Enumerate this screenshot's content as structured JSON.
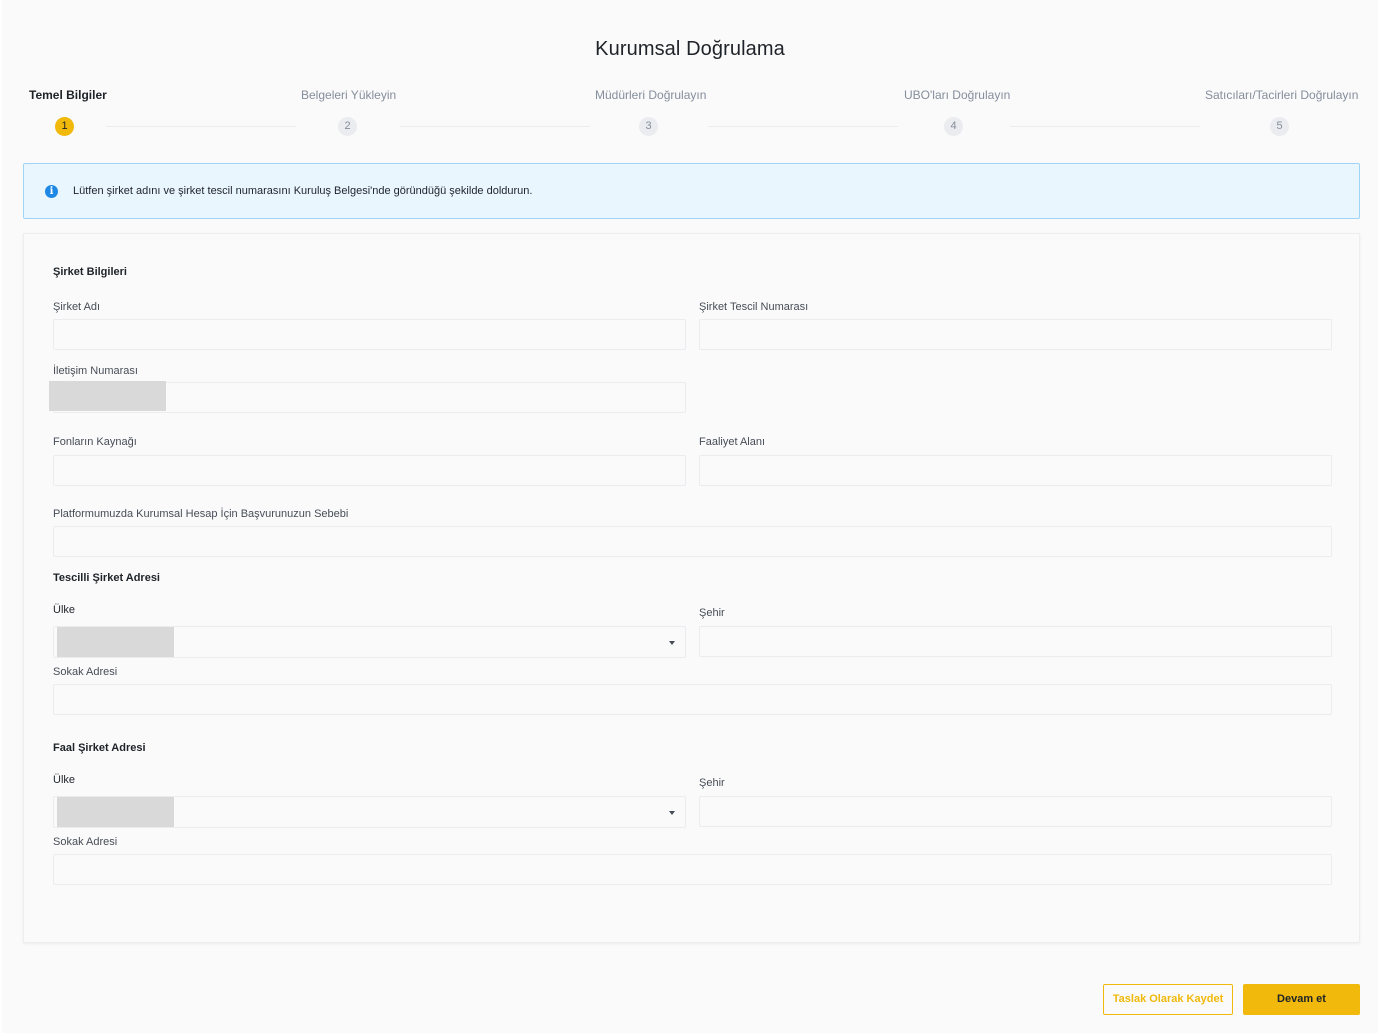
{
  "page": {
    "title": "Kurumsal Doğrulama"
  },
  "stepper": {
    "steps": [
      {
        "number": "1",
        "label": "Temel Bilgiler",
        "active": true
      },
      {
        "number": "2",
        "label": "Belgeleri Yükleyin",
        "active": false
      },
      {
        "number": "3",
        "label": "Müdürleri Doğrulayın",
        "active": false
      },
      {
        "number": "4",
        "label": "UBO'ları Doğrulayın",
        "active": false
      },
      {
        "number": "5",
        "label": "Satıcıları/Tacirleri Doğrulayın",
        "active": false
      }
    ]
  },
  "info_banner": {
    "icon": "info-icon",
    "text": "Lütfen şirket adını ve şirket tescil numarasını Kuruluş Belgesi'nde göründüğü şekilde doldurun."
  },
  "company_info": {
    "title": "Şirket Bilgileri",
    "company_name_label": "Şirket Adı",
    "company_name_value": "",
    "registration_number_label": "Şirket Tescil Numarası",
    "registration_number_value": "",
    "contact_number_label": "İletişim Numarası",
    "contact_number_value": "",
    "source_of_funds_label": "Fonların Kaynağı",
    "source_of_funds_value": "",
    "business_area_label": "Faaliyet Alanı",
    "business_area_value": "",
    "reason_label": "Platformumuzda Kurumsal Hesap İçin Başvurunuzun Sebebi",
    "reason_value": ""
  },
  "registered_address": {
    "title": "Tescilli Şirket Adresi",
    "country_label": "Ülke",
    "city_label": "Şehir",
    "city_value": "",
    "street_label": "Sokak Adresi",
    "street_value": ""
  },
  "operating_address": {
    "title": "Faal Şirket Adresi",
    "country_label": "Ülke",
    "city_label": "Şehir",
    "city_value": "",
    "street_label": "Sokak Adresi",
    "street_value": ""
  },
  "actions": {
    "save_draft_label": "Taslak Olarak Kaydet",
    "continue_label": "Devam et"
  },
  "colors": {
    "accent": "#f0b90b",
    "info_background": "#eaf6fe",
    "info_border": "#9fd4f7",
    "info_icon": "#1e88e5"
  }
}
